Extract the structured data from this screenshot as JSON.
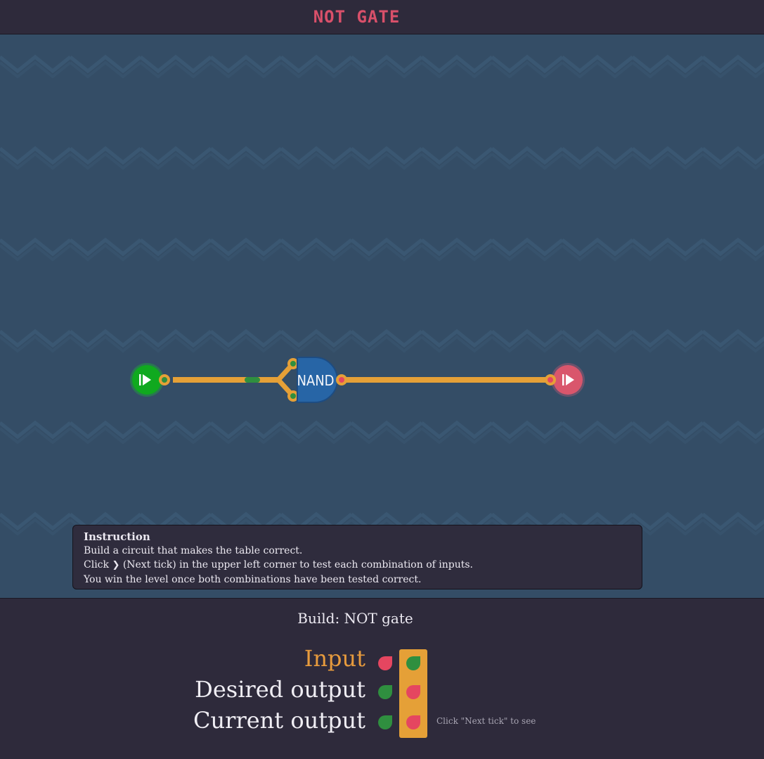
{
  "header": {
    "title": "NOT GATE"
  },
  "circuit": {
    "gate_label": "NAND",
    "input_node": "play-icon",
    "output_node": "play-icon"
  },
  "instruction": {
    "title": "Instruction",
    "line1": "Build a circuit that makes the table correct.",
    "line2_before": "Click",
    "line2_icon": "chevron-right-icon",
    "line2_after": "(Next tick) in the upper left corner to test each combination of inputs.",
    "line3": "You win the level once both combinations have been tested correct."
  },
  "truth_table": {
    "title": "Build: NOT gate",
    "rows": [
      {
        "label": "Input",
        "values": [
          "off",
          "on"
        ]
      },
      {
        "label": "Desired output",
        "values": [
          "on",
          "off"
        ]
      },
      {
        "label": "Current output",
        "values": [
          "on",
          "off"
        ]
      }
    ],
    "selected_column": 1,
    "hint": "Click \"Next tick\" to see"
  },
  "colors": {
    "on": "#2f8f3f",
    "off": "#e54660",
    "wire": "#e5a037",
    "gate": "#2765a6",
    "highlight": "#e5a037",
    "title": "#d9506a"
  }
}
